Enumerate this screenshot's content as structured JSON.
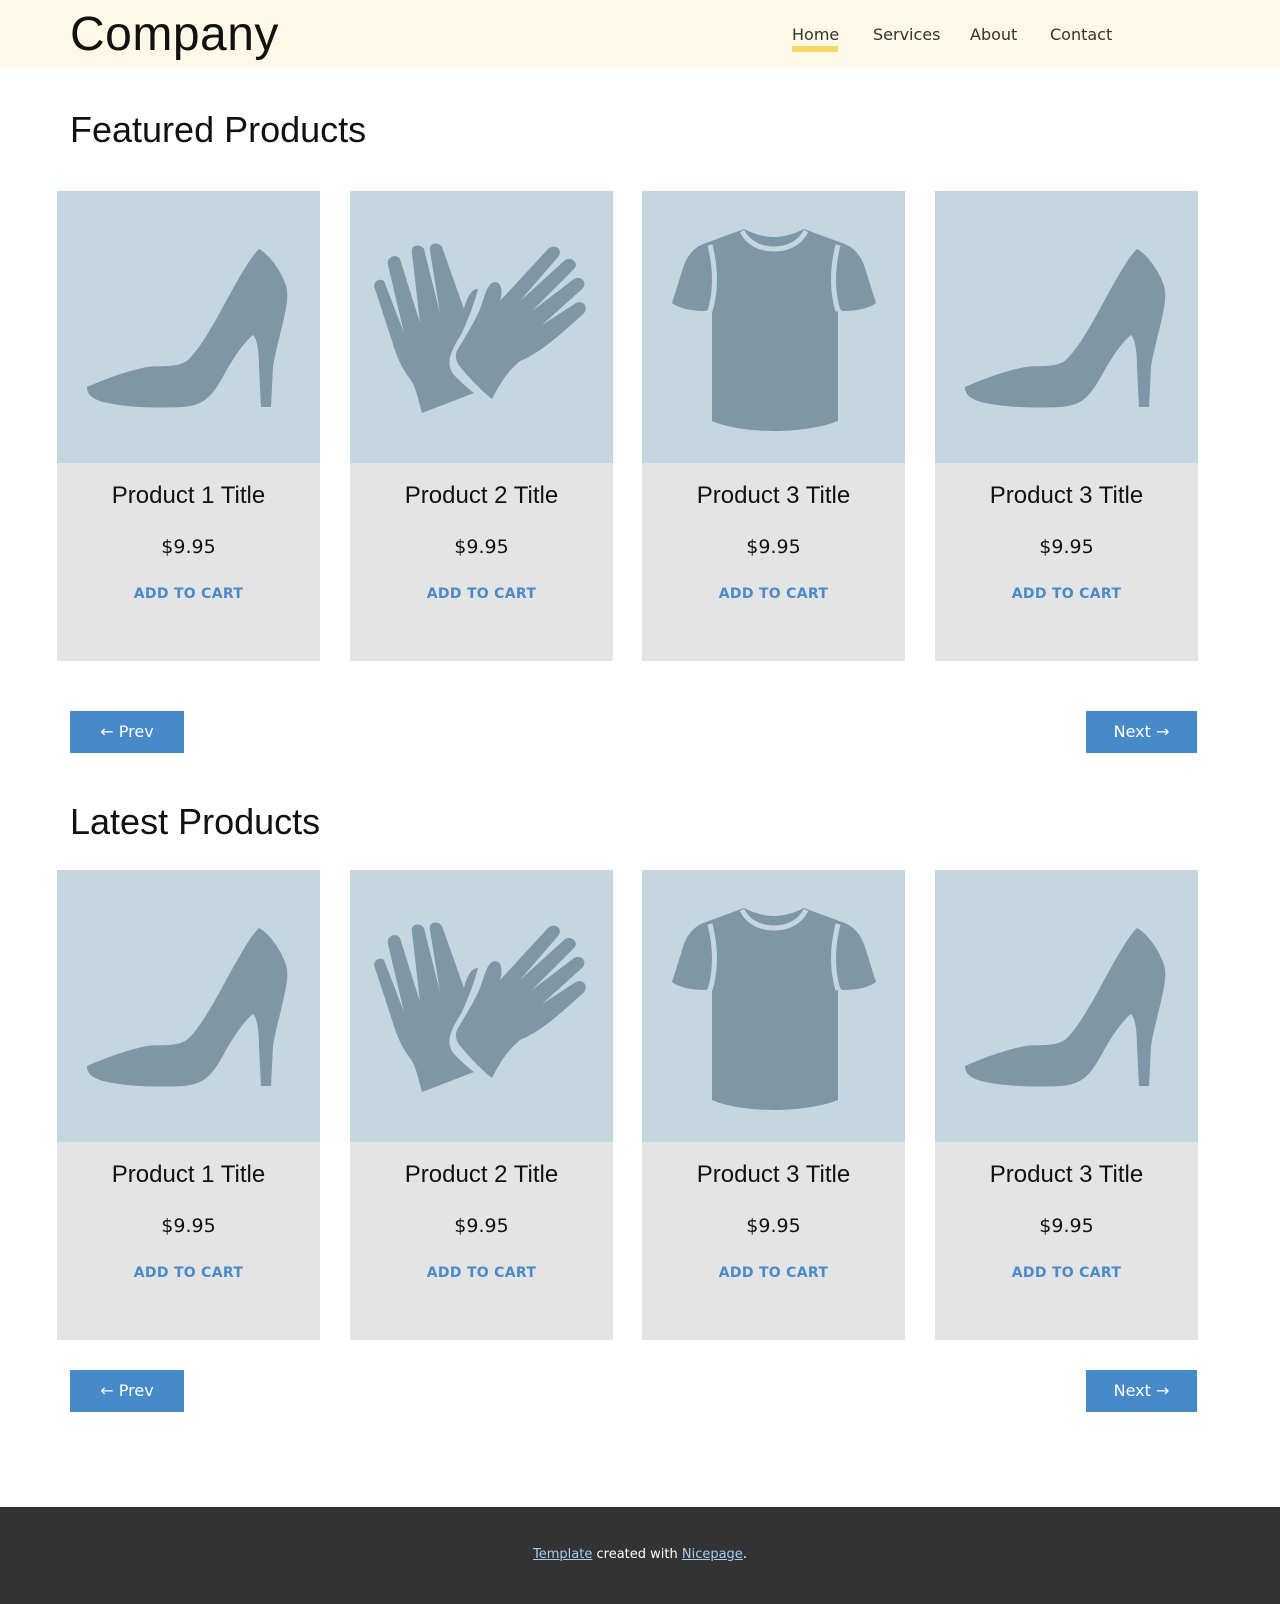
{
  "header": {
    "logo": "Company",
    "nav": [
      {
        "label": "Home",
        "active": true
      },
      {
        "label": "Services",
        "active": false
      },
      {
        "label": "About",
        "active": false
      },
      {
        "label": "Contact",
        "active": false
      }
    ]
  },
  "featured": {
    "title": "Featured Products",
    "products": [
      {
        "title": "Product 1 Title",
        "price": "$9.95",
        "cta": "ADD TO CART",
        "icon": "high-heel-shoe-icon"
      },
      {
        "title": "Product 2 Title",
        "price": "$9.95",
        "cta": "ADD TO CART",
        "icon": "gloves-icon"
      },
      {
        "title": "Product 3 Title",
        "price": "$9.95",
        "cta": "ADD TO CART",
        "icon": "tshirt-icon"
      },
      {
        "title": "Product 3 Title",
        "price": "$9.95",
        "cta": "ADD TO CART",
        "icon": "high-heel-shoe-icon"
      }
    ],
    "prev_label": "← Prev",
    "next_label": "Next →"
  },
  "latest": {
    "title": "Latest Products",
    "products": [
      {
        "title": "Product 1 Title",
        "price": "$9.95",
        "cta": "ADD TO CART",
        "icon": "high-heel-shoe-icon"
      },
      {
        "title": "Product 2 Title",
        "price": "$9.95",
        "cta": "ADD TO CART",
        "icon": "gloves-icon"
      },
      {
        "title": "Product 3 Title",
        "price": "$9.95",
        "cta": "ADD TO CART",
        "icon": "tshirt-icon"
      },
      {
        "title": "Product 3 Title",
        "price": "$9.95",
        "cta": "ADD TO CART",
        "icon": "high-heel-shoe-icon"
      }
    ],
    "prev_label": "← Prev",
    "next_label": "Next →"
  },
  "footer": {
    "link1": "Template",
    "middle": " created with ",
    "link2": "Nicepage",
    "end": "."
  },
  "colors": {
    "header_bg": "#fef8e6",
    "nav_underline": "#f5d763",
    "card_image_bg": "#c4d7e1",
    "icon_fill": "#7f96a6",
    "card_bg": "#e4e4e4",
    "accent": "#478ac9",
    "footer_bg": "#333333"
  }
}
